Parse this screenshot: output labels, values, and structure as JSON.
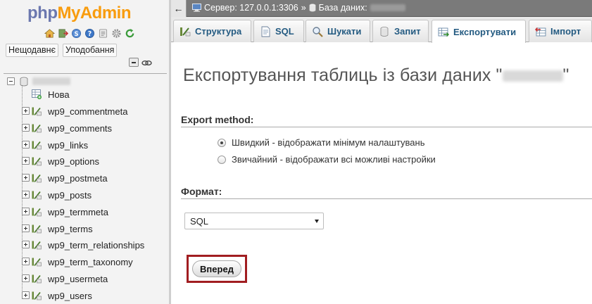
{
  "logo": {
    "php": "php",
    "myadmin": "MyAdmin"
  },
  "nav": {
    "icons": [
      "home-icon",
      "logout-icon",
      "query-window-icon",
      "docs-icon",
      "settings-icon",
      "reload-icon"
    ],
    "recent_label": "Нещодавнє",
    "favorites_label": "Уподобання",
    "new_label": "Нова",
    "tables": [
      "wp9_commentmeta",
      "wp9_comments",
      "wp9_links",
      "wp9_options",
      "wp9_postmeta",
      "wp9_posts",
      "wp9_termmeta",
      "wp9_terms",
      "wp9_term_relationships",
      "wp9_term_taxonomy",
      "wp9_usermeta",
      "wp9_users"
    ]
  },
  "breadcrumb": {
    "server": "Сервер: 127.0.0.1:3306",
    "separator": "»",
    "database": "База даних:"
  },
  "tabs": [
    {
      "label": "Структура",
      "icon": "structure-icon",
      "active": false
    },
    {
      "label": "SQL",
      "icon": "sql-icon",
      "active": false
    },
    {
      "label": "Шукати",
      "icon": "search-icon",
      "active": false
    },
    {
      "label": "Запит",
      "icon": "query-icon",
      "active": false
    },
    {
      "label": "Експортувати",
      "icon": "export-icon",
      "active": true
    },
    {
      "label": "Імпорт",
      "icon": "import-icon",
      "active": false
    }
  ],
  "main": {
    "title_prefix": "Експортування таблиць із бази даних \"",
    "title_suffix": "\"",
    "export_method_label": "Export method:",
    "method_quick": "Швидкий - відображати мінімум налаштувань",
    "method_custom": "Звичайний - відображати всі можливі настройки",
    "format_label": "Формат:",
    "format_value": "SQL",
    "go_label": "Вперед"
  },
  "colors": {
    "accent_red": "#a11d21",
    "tab_text": "#235a81",
    "logo_blue": "#6c78af",
    "logo_orange": "#f89c0e"
  }
}
